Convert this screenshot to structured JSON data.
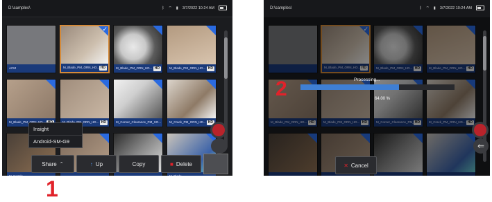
{
  "left_panel": {
    "path": "D:\\samples\\",
    "time": "3/7/2022  10:24 AM",
    "thumbs": [
      {
        "label": "ACM",
        "kind": "folder"
      },
      {
        "label": "M_Blade_PM_ORN_HD...",
        "hd": "HD",
        "selected": true
      },
      {
        "label": "M_Blade_PM_ORN_HD...",
        "hd": "HD"
      },
      {
        "label": "M_Blade_PM_ORN_HD...",
        "hd": "HD"
      },
      {
        "label": "M_Blade_PM_ORN_HD...",
        "hd": "HD"
      },
      {
        "label": "M_Blade_PM_ORN_HD...",
        "hd": "HD"
      },
      {
        "label": "M_Corner_Clearance_PM_SO...",
        "hd": ""
      },
      {
        "label": "M_Crack_PM_ORN_HD...",
        "hd": "HD"
      },
      {
        "label": "M_Nozzle...",
        "hd": ""
      },
      {
        "label": "",
        "hd": ""
      },
      {
        "label": "",
        "hd": ""
      },
      {
        "label": "M_Blade...",
        "hd": ""
      }
    ],
    "share_menu": [
      "Insight",
      "Android-SM-G9"
    ],
    "buttons": {
      "share": "Share",
      "up": "Up",
      "copy": "Copy",
      "delete": "Delete"
    },
    "step": "1"
  },
  "right_panel": {
    "path": "D:\\samples\\",
    "time": "3/7/2022  10:24 AM",
    "processing": "Processing...",
    "progress_percent": 64.0,
    "progress_label": "64.00 %",
    "cancel": "Cancel",
    "step": "2",
    "thumbs": [
      {
        "label": "",
        "kind": "folder"
      },
      {
        "label": "M_Blade_PM_ORN_HD...",
        "hd": "HD",
        "selected": true
      },
      {
        "label": "M_Blade_PM_ORN_HD...",
        "hd": "HD"
      },
      {
        "label": "M_Blade_PM_ORN_HD...",
        "hd": "HD"
      },
      {
        "label": "M_Blade_PM_ORN_HD...",
        "hd": "HD"
      },
      {
        "label": "M_Blade_PM_ORN_HD...",
        "hd": "HD"
      },
      {
        "label": "M_Corner_Clearance_PM_SO...",
        "hd": "HD"
      },
      {
        "label": "M_Crack_PM_ORN_HD...",
        "hd": "HD"
      },
      {
        "label": "",
        "hd": ""
      },
      {
        "label": "",
        "hd": ""
      },
      {
        "label": "",
        "hd": ""
      },
      {
        "label": "",
        "hd": ""
      }
    ]
  },
  "colors": {
    "accent": "#2a6ae0",
    "record": "#b8232b",
    "annotation": "#e1222a",
    "progress": "#3f7fd4"
  }
}
